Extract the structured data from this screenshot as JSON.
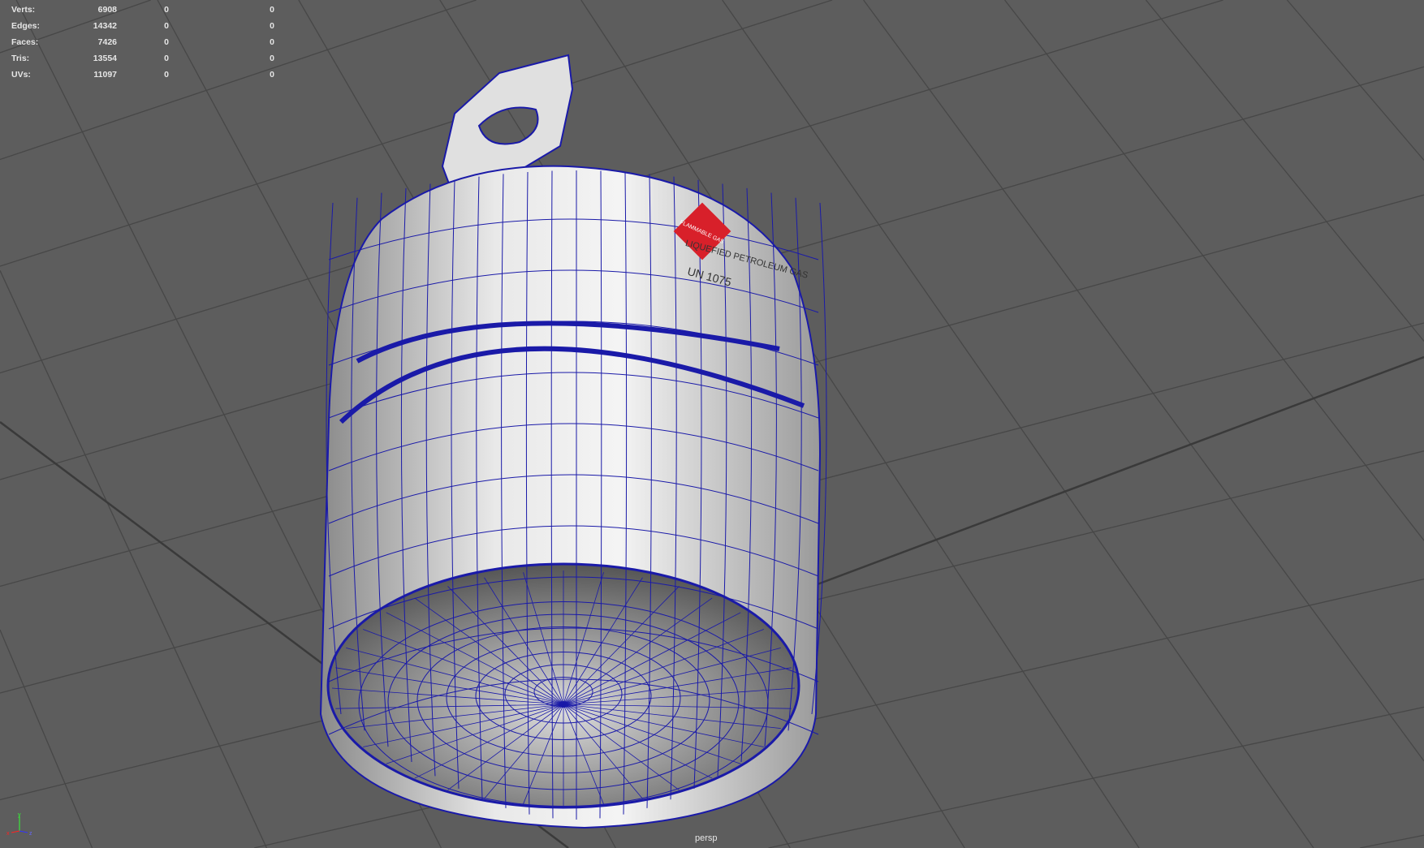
{
  "hud": {
    "rows": [
      {
        "label": "Verts:",
        "total": "6908",
        "selected": "0",
        "uv": "0"
      },
      {
        "label": "Edges:",
        "total": "14342",
        "selected": "0",
        "uv": "0"
      },
      {
        "label": "Faces:",
        "total": "7426",
        "selected": "0",
        "uv": "0"
      },
      {
        "label": "Tris:",
        "total": "13554",
        "selected": "0",
        "uv": "0"
      },
      {
        "label": "UVs:",
        "total": "11097",
        "selected": "0",
        "uv": "0"
      }
    ]
  },
  "label_text": {
    "flammable": "FLAMMABLE GAS",
    "lpg": "LIQUEFIED PETROLEUM GAS",
    "un": "UN 1075"
  },
  "camera": "persp",
  "axis_icon": {
    "x": "x",
    "y": "y",
    "z": "z"
  },
  "colors": {
    "background": "#5d5d5d",
    "wire": "#1a1aa8",
    "grid": "#474747"
  }
}
